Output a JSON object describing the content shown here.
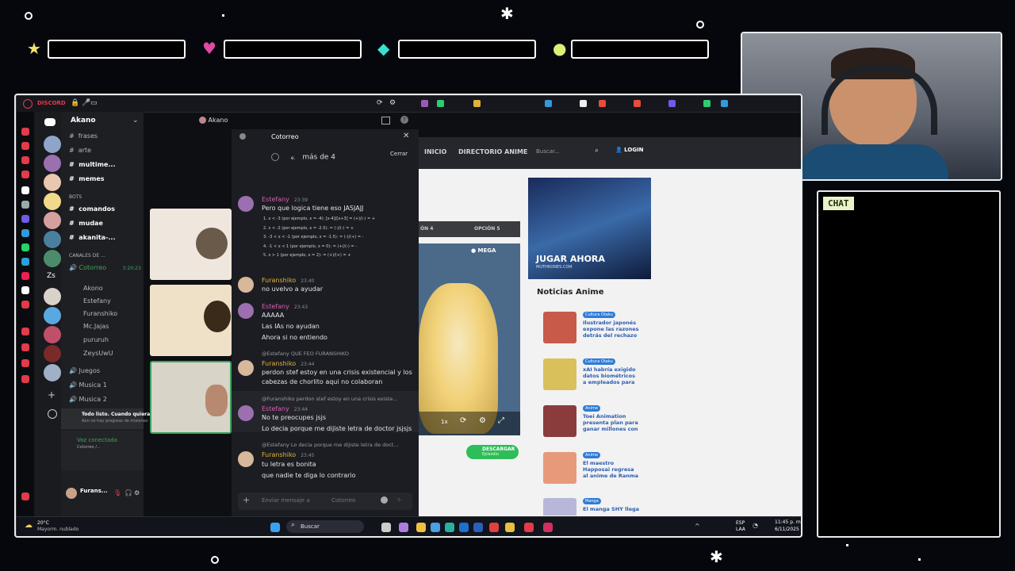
{
  "overlay": {
    "chat_label": "CHAT"
  },
  "discord": {
    "app_name": "DISCORD",
    "window_title": "Akano",
    "server_name": "Akano",
    "channels": [
      {
        "name": "frases"
      },
      {
        "name": "arte"
      },
      {
        "name": "multime..."
      },
      {
        "name": "memes"
      },
      {
        "name": "BOTS"
      },
      {
        "name": "comandos"
      },
      {
        "name": "mudae"
      },
      {
        "name": "akanita-..."
      },
      {
        "name": "CANALES DE ..."
      },
      {
        "name": "Cotorreo"
      }
    ],
    "voice_time": "3:20:23",
    "voice_users": [
      "Akono",
      "Estefany",
      "Furanshiko",
      "Mc.Jajas",
      "pururuh",
      "ZeysUwU"
    ],
    "voice_channels": [
      "Juegos",
      "Musica 1",
      "Musica 2"
    ],
    "activity_title": "Todo listo. Cuando quieras...",
    "activity_sub": "Aún no hay progreso de misiones",
    "voice_status": "Voz conectada",
    "voice_sub": "Cotorreo /...",
    "user_name": "Furans...",
    "chat": {
      "title": "Cotorreo",
      "close_tooltip": "Cerrar",
      "poll_option": "más de 4",
      "poll_letter": "e.",
      "input_placeholder": "Enviar mensaje a",
      "input_channel": "Cotorreo",
      "messages": [
        {
          "author": "Estefany",
          "time": "23:39",
          "text": "Pero que logica tiene eso JASJAJJ"
        },
        {
          "author": "Furanshiko",
          "time": "23:40",
          "text": "no uvelvo a ayudar"
        },
        {
          "author": "Estefany",
          "time": "23:43",
          "text": "AAAAA"
        },
        {
          "author": "",
          "time": "",
          "text": "Las IAs no ayudan"
        },
        {
          "author": "",
          "time": "",
          "text": "Ahora si no entiendo"
        },
        {
          "author": "Furanshiko",
          "time": "23:44",
          "text": "perdon stef estoy en una crisis existencial y los"
        },
        {
          "author": "",
          "time": "",
          "text": "cabezas de chorlito aqui no colaboran"
        },
        {
          "author": "Estefany",
          "time": "23:44",
          "text": "No te preocupes jsjs"
        },
        {
          "author": "",
          "time": "",
          "text": "Lo decia porque me dijiste letra de doctor jsjsjs"
        },
        {
          "author": "Furanshiko",
          "time": "23:45",
          "text": "tu letra es bonita"
        },
        {
          "author": "",
          "time": "",
          "text": "que nadie te diga lo contrario"
        }
      ],
      "replies": [
        "@Estefany QUE FEO FURANSHIKO",
        "@Furanshiko perdon stef estoy en una crisis existe...",
        "@Estefany Lo decia porque me dijiste letra de doct..."
      ],
      "math_lines": [
        "1.  x < -3 (por ejemplo, x = -4): [x-4]/[x+3] = (+)/(-) = +",
        "2.  x < -2 (por ejemplo, x = -2.5): = (-)/(-) = +",
        "3.  -3 < x < -1 (por ejemplo, x = -1.5): = (-)/(+) = -",
        "4.  -1 < x < 1 (por ejemplo, x = 0): = (+)/(-) = -",
        "5.  x > 1 (por ejemplo, x = 2): = (+)/(+) = +"
      ]
    }
  },
  "website": {
    "nav": [
      "INICIO",
      "DIRECTORIO ANIME"
    ],
    "search_placeholder": "Buscar...",
    "login": "LOGIN",
    "options": [
      "ÓN 4",
      "OPCIÓN 5"
    ],
    "player_label": "MEGA",
    "player_speed": "1x",
    "download_label": "DESCARGAR",
    "download_sub": "Episodio",
    "ad_title": "JUGAR AHORA",
    "ad_sub": "MUTHRONES.COM",
    "news_heading": "Noticias Anime",
    "news": [
      {
        "tag": "Cultura Otaku",
        "title": "Ilustrador japonés expone las razones detrás del rechazo",
        "thumb": "#c85a4a",
        "tagcolor": "#2e7bd6"
      },
      {
        "tag": "Cultura Otaku",
        "title": "xAI habría exigido datos biométricos a empleados para",
        "thumb": "#d9c05a",
        "tagcolor": "#2e7bd6"
      },
      {
        "tag": "Anime",
        "title": "Toei Animation presenta plan para ganar millones con",
        "thumb": "#8a3c3c",
        "tagcolor": "#2e7bd6"
      },
      {
        "tag": "Anime",
        "title": "El maestro Happosai regresa al anime de Ranma",
        "thumb": "#e79a7a",
        "tagcolor": "#2e7bd6"
      },
      {
        "tag": "Manga",
        "title": "El manga SHY llega",
        "thumb": "#b9b7d9",
        "tagcolor": "#2e7bd6"
      }
    ]
  },
  "taskbar": {
    "weather_temp": "20°C",
    "weather_desc": "Mayorm. nublado",
    "search": "Buscar",
    "lang": "ESP",
    "lang_sub": "LAA",
    "time": "11:45 p. m.",
    "date": "6/11/2025"
  }
}
